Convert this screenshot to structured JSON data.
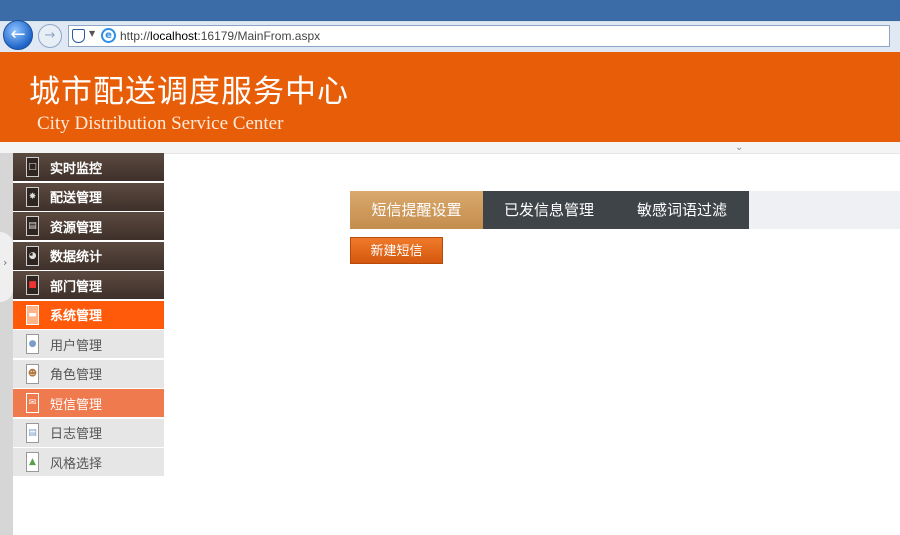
{
  "browser": {
    "url_prefix": "http://",
    "url_host": "localhost",
    "url_rest": ":16179/MainFrom.aspx"
  },
  "header": {
    "title": "城市配送调度服务中心",
    "subtitle": "City Distribution Service Center"
  },
  "menu": [
    {
      "label": "实时监控",
      "style": "dark",
      "icon": "monitor-icon"
    },
    {
      "label": "配送管理",
      "style": "dark",
      "icon": "gear-icon"
    },
    {
      "label": "资源管理",
      "style": "dark",
      "icon": "box-icon"
    },
    {
      "label": "数据统计",
      "style": "dark",
      "icon": "chart-icon"
    },
    {
      "label": "部门管理",
      "style": "dark",
      "icon": "department-icon"
    },
    {
      "label": "系统管理",
      "style": "active",
      "icon": "system-icon"
    },
    {
      "label": "用户管理",
      "style": "sub",
      "icon": "user-icon"
    },
    {
      "label": "角色管理",
      "style": "sub",
      "icon": "role-icon"
    },
    {
      "label": "短信管理",
      "style": "sub-active",
      "icon": "message-icon"
    },
    {
      "label": "日志管理",
      "style": "sub",
      "icon": "log-icon"
    },
    {
      "label": "风格选择",
      "style": "sub",
      "icon": "theme-icon"
    }
  ],
  "tabs": {
    "t1": "短信提醒设置",
    "t2": "已发信息管理",
    "t3": "敏感词语过滤"
  },
  "actions": {
    "new_sms": "新建短信"
  },
  "colors": {
    "header_orange": "#e85e08",
    "active_menu": "#ff5a0a",
    "active_tab": "#c48d4d",
    "dark_tab": "#3f4449"
  }
}
